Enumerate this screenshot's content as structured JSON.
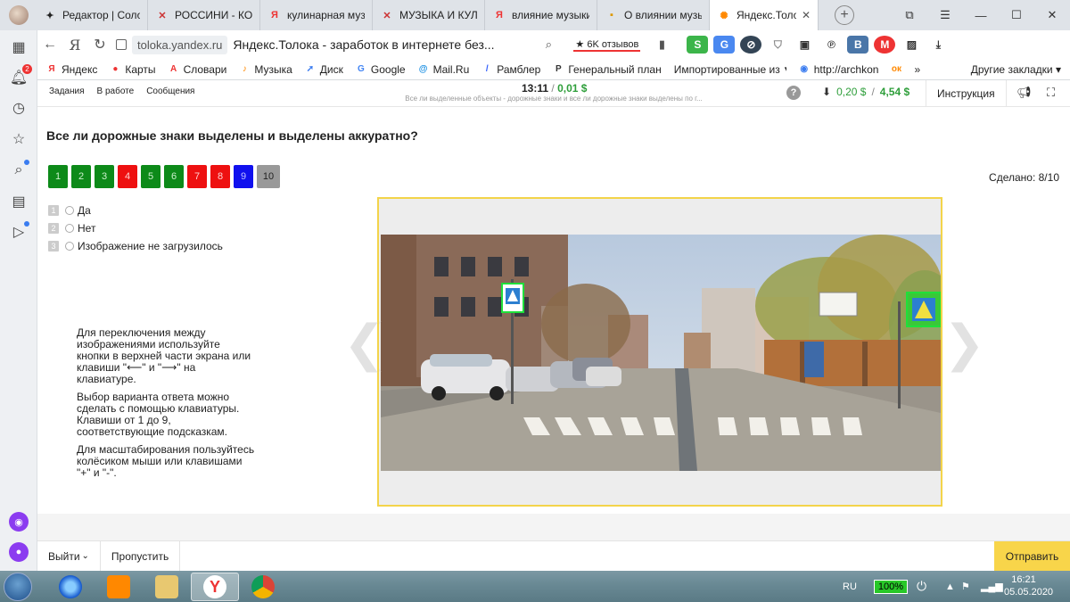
{
  "browser": {
    "tabs": [
      {
        "title": "Редактор | Соло",
        "icon": "dzen-icon",
        "icon_glyph": "✦",
        "icon_color": "#222"
      },
      {
        "title": "РОССИНИ - КОМ",
        "icon": "picture-icon",
        "icon_glyph": "✕",
        "icon_color": "#c33"
      },
      {
        "title": "кулинарная муз",
        "icon": "yandex-icon",
        "icon_glyph": "Я",
        "icon_color": "#e33"
      },
      {
        "title": "МУЗЫКА И КУЛИ",
        "icon": "picture-icon",
        "icon_glyph": "✕",
        "icon_color": "#c33"
      },
      {
        "title": "влияние музыки",
        "icon": "yandex-icon",
        "icon_glyph": "Я",
        "icon_color": "#e33"
      },
      {
        "title": "О влиянии музы",
        "icon": "page-icon",
        "icon_glyph": "▪",
        "icon_color": "#d90"
      }
    ],
    "active_tab": {
      "title": "Яндекс.Толок",
      "close": "✕"
    },
    "new_tab": "+",
    "url_host": "toloka.yandex.ru",
    "page_title": "Яндекс.Толока - заработок в интернете без...",
    "reviews": "★ 6K отзывов",
    "bookmarks": [
      {
        "label": "Яндекс",
        "icon": "yandex-icon",
        "glyph": "Я",
        "color": "#e33"
      },
      {
        "label": "Карты",
        "icon": "map-pin-icon",
        "glyph": "●",
        "color": "#e33"
      },
      {
        "label": "Словари",
        "icon": "dictionary-icon",
        "glyph": "A",
        "color": "#e33"
      },
      {
        "label": "Музыка",
        "icon": "music-icon",
        "glyph": "♪",
        "color": "#f80"
      },
      {
        "label": "Диск",
        "icon": "disk-icon",
        "glyph": "➚",
        "color": "#3a7cf0"
      },
      {
        "label": "Google",
        "icon": "google-icon",
        "glyph": "G",
        "color": "#4285f4"
      },
      {
        "label": "Mail.Ru",
        "icon": "mail-icon",
        "glyph": "@",
        "color": "#168de2"
      },
      {
        "label": "Рамблер",
        "icon": "rambler-icon",
        "glyph": "/",
        "color": "#315efb"
      },
      {
        "label": "Генеральный план",
        "icon": "plan-icon",
        "glyph": "P",
        "color": "#333"
      },
      {
        "label": "Импортированные из",
        "icon": "folder-icon",
        "glyph": "",
        "color": "#333"
      },
      {
        "label": "http://archkon",
        "icon": "globe-icon",
        "glyph": "◉",
        "color": "#3a7cf0"
      },
      {
        "label": "",
        "icon": "ok-icon",
        "glyph": "ок",
        "color": "#f80"
      }
    ],
    "bookmarks_more": "»",
    "other_bookmarks": "Другие закладки ▾"
  },
  "toloka": {
    "nav": [
      "Задания",
      "В работе",
      "Сообщения"
    ],
    "timer": "13:11",
    "timer_sep": "/",
    "reward": "0,01 $",
    "description": "Все ли выделенные объекты - дорожные знаки и все ли дорожные знаки выделены по г...",
    "help": "?",
    "balance_hold": "0,20 $",
    "balance_sep": "/",
    "balance": "4,54 $",
    "instruction": "Инструкция"
  },
  "task": {
    "question": "Все ли дорожные знаки выделены и выделены аккуратно?",
    "tasks": [
      {
        "label": "1",
        "status": "green"
      },
      {
        "label": "2",
        "status": "green"
      },
      {
        "label": "3",
        "status": "green"
      },
      {
        "label": "4",
        "status": "red"
      },
      {
        "label": "5",
        "status": "green"
      },
      {
        "label": "6",
        "status": "green"
      },
      {
        "label": "7",
        "status": "red"
      },
      {
        "label": "8",
        "status": "red"
      },
      {
        "label": "9",
        "status": "blue"
      },
      {
        "label": "10",
        "status": "gray"
      }
    ],
    "done": "Сделано: 8/10",
    "options": [
      {
        "key": "1",
        "label": "Да"
      },
      {
        "key": "2",
        "label": "Нет"
      },
      {
        "key": "3",
        "label": "Изображение не загрузилось"
      }
    ],
    "hints": [
      "Для переключения между изображениями используйте кнопки в верхней части экрана или клавиши \"⟵\" и \"⟶\" на клавиатуре.",
      "Выбор варианта ответа можно сделать с помощью клавиатуры. Клавиши от 1 до 9, соответствующие подсказкам.",
      "Для масштабирования пользуйтесь колёсиком мыши или клавишами \"+\" и \"-\"."
    ],
    "prev_arrow": "❮",
    "next_arrow": "❯"
  },
  "footer": {
    "exit": "Выйти",
    "skip": "Пропустить",
    "submit": "Отправить"
  },
  "taskbar": {
    "lang": "RU",
    "battery": "100%",
    "time": "16:21",
    "date": "05.05.2020"
  }
}
